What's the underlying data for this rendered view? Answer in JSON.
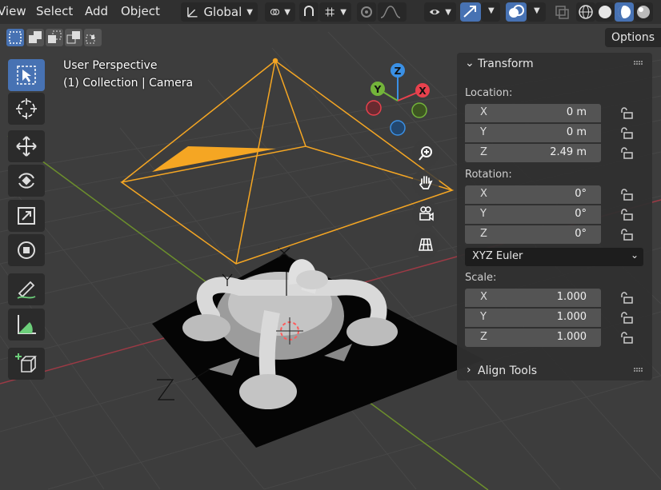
{
  "header": {
    "menu": [
      "View",
      "Select",
      "Add",
      "Object"
    ],
    "orientation_label": "Global",
    "options_label": "Options"
  },
  "viewport": {
    "perspective_label": "User Perspective",
    "collection_label": "(1) Collection | Camera"
  },
  "gizmo": {
    "x": "X",
    "y": "Y",
    "z": "Z"
  },
  "panel": {
    "transform_title": "Transform",
    "location_label": "Location:",
    "location": [
      {
        "axis": "X",
        "value": "0 m"
      },
      {
        "axis": "Y",
        "value": "0 m"
      },
      {
        "axis": "Z",
        "value": "2.49 m"
      }
    ],
    "rotation_label": "Rotation:",
    "rotation": [
      {
        "axis": "X",
        "value": "0°"
      },
      {
        "axis": "Y",
        "value": "0°"
      },
      {
        "axis": "Z",
        "value": "0°"
      }
    ],
    "rotation_mode": "XYZ Euler",
    "scale_label": "Scale:",
    "scale": [
      {
        "axis": "X",
        "value": "1.000"
      },
      {
        "axis": "Y",
        "value": "1.000"
      },
      {
        "axis": "Z",
        "value": "1.000"
      }
    ],
    "align_title": "Align Tools"
  },
  "colors": {
    "accent": "#4772b3",
    "camera": "#f5a623",
    "x_axis": "#e8414d",
    "y_axis": "#73b43a",
    "z_axis": "#3a90e5"
  }
}
